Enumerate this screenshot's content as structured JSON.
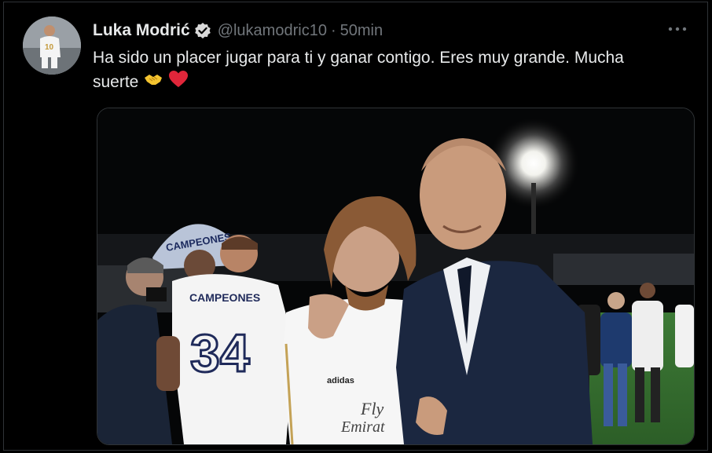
{
  "tweet": {
    "author_name": "Luka Modrić",
    "handle": "@lukamodric10",
    "separator": "·",
    "time": "50min",
    "text_line1": "Ha sido un placer jugar para ti y ganar contigo. Eres muy grande. Mucha",
    "text_line2": "suerte",
    "emojis": [
      "handshake-icon",
      "red-heart-icon"
    ]
  },
  "photo": {
    "banner_text": "CAMPEONES",
    "jersey_back_text": "CAMPEONES",
    "jersey_number": "34",
    "shirt_sponsor": "Fly",
    "shirt_sponsor_2": "Emirat",
    "brand": "adidas",
    "avatar_number": "10"
  },
  "colors": {
    "background": "#000000",
    "text": "#e7e9ea",
    "muted": "#71767b",
    "border": "#2f3336",
    "heart": "#e0263a"
  }
}
